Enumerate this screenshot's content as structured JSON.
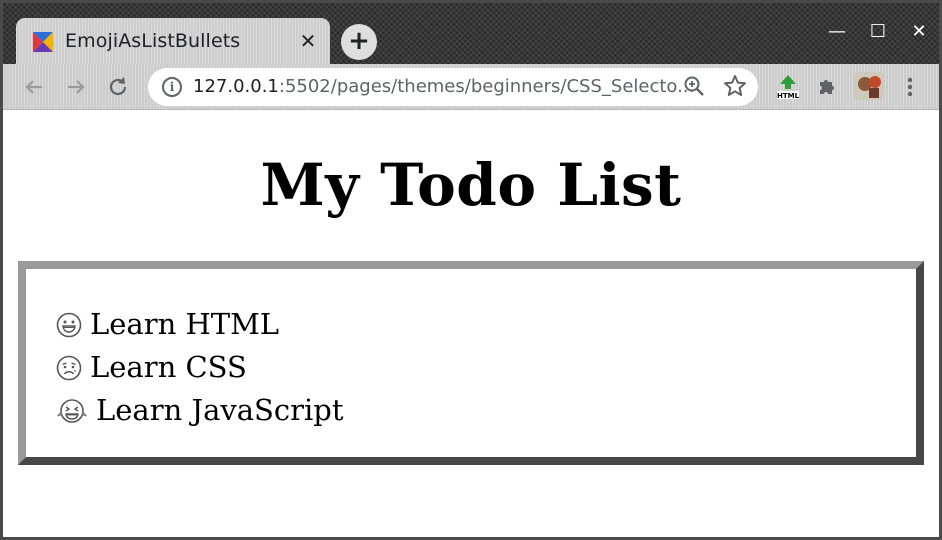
{
  "browser": {
    "tab_title": "EmojiAsListBullets",
    "tab_close": "✕",
    "new_tab": "+",
    "url_host": "127.0.0.1",
    "url_rest": ":5502/pages/themes/beginners/CSS_Selecto...",
    "window_controls": {
      "minimize": "—",
      "maximize": "☐",
      "close": "✕"
    },
    "icons": [
      "back-arrow-icon",
      "forward-arrow-icon",
      "reload-icon",
      "info-icon",
      "zoom-icon",
      "star-icon",
      "html-extension-icon",
      "puzzle-icon",
      "avatar",
      "kebab-menu-icon"
    ]
  },
  "page": {
    "title": "My Todo List",
    "items": [
      {
        "label": "Learn HTML",
        "icon": "grinning-face-icon"
      },
      {
        "label": "Learn CSS",
        "icon": "worried-face-icon"
      },
      {
        "label": "Learn JavaScript",
        "icon": "crying-laughing-face-icon"
      }
    ]
  },
  "colors": {
    "box_border_light": "#9a9a9a",
    "box_border_dark": "#474747"
  }
}
